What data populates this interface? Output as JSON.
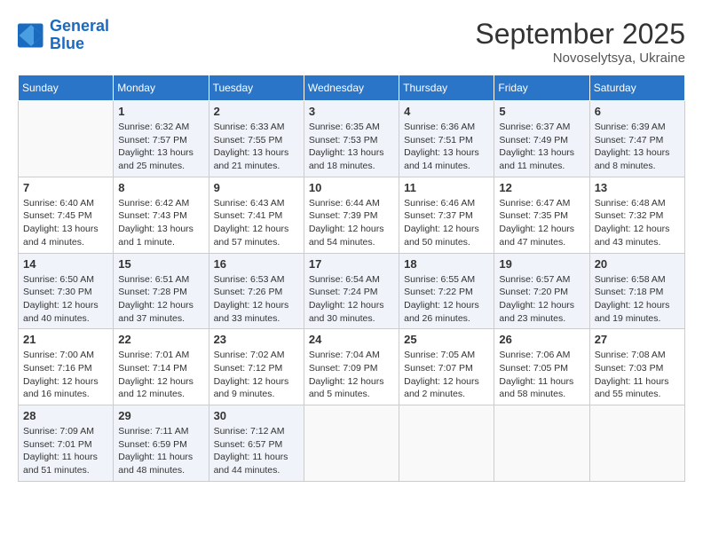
{
  "header": {
    "logo_line1": "General",
    "logo_line2": "Blue",
    "month": "September 2025",
    "location": "Novoselytsya, Ukraine"
  },
  "weekdays": [
    "Sunday",
    "Monday",
    "Tuesday",
    "Wednesday",
    "Thursday",
    "Friday",
    "Saturday"
  ],
  "weeks": [
    [
      {
        "day": "",
        "info": ""
      },
      {
        "day": "1",
        "info": "Sunrise: 6:32 AM\nSunset: 7:57 PM\nDaylight: 13 hours\nand 25 minutes."
      },
      {
        "day": "2",
        "info": "Sunrise: 6:33 AM\nSunset: 7:55 PM\nDaylight: 13 hours\nand 21 minutes."
      },
      {
        "day": "3",
        "info": "Sunrise: 6:35 AM\nSunset: 7:53 PM\nDaylight: 13 hours\nand 18 minutes."
      },
      {
        "day": "4",
        "info": "Sunrise: 6:36 AM\nSunset: 7:51 PM\nDaylight: 13 hours\nand 14 minutes."
      },
      {
        "day": "5",
        "info": "Sunrise: 6:37 AM\nSunset: 7:49 PM\nDaylight: 13 hours\nand 11 minutes."
      },
      {
        "day": "6",
        "info": "Sunrise: 6:39 AM\nSunset: 7:47 PM\nDaylight: 13 hours\nand 8 minutes."
      }
    ],
    [
      {
        "day": "7",
        "info": "Sunrise: 6:40 AM\nSunset: 7:45 PM\nDaylight: 13 hours\nand 4 minutes."
      },
      {
        "day": "8",
        "info": "Sunrise: 6:42 AM\nSunset: 7:43 PM\nDaylight: 13 hours\nand 1 minute."
      },
      {
        "day": "9",
        "info": "Sunrise: 6:43 AM\nSunset: 7:41 PM\nDaylight: 12 hours\nand 57 minutes."
      },
      {
        "day": "10",
        "info": "Sunrise: 6:44 AM\nSunset: 7:39 PM\nDaylight: 12 hours\nand 54 minutes."
      },
      {
        "day": "11",
        "info": "Sunrise: 6:46 AM\nSunset: 7:37 PM\nDaylight: 12 hours\nand 50 minutes."
      },
      {
        "day": "12",
        "info": "Sunrise: 6:47 AM\nSunset: 7:35 PM\nDaylight: 12 hours\nand 47 minutes."
      },
      {
        "day": "13",
        "info": "Sunrise: 6:48 AM\nSunset: 7:32 PM\nDaylight: 12 hours\nand 43 minutes."
      }
    ],
    [
      {
        "day": "14",
        "info": "Sunrise: 6:50 AM\nSunset: 7:30 PM\nDaylight: 12 hours\nand 40 minutes."
      },
      {
        "day": "15",
        "info": "Sunrise: 6:51 AM\nSunset: 7:28 PM\nDaylight: 12 hours\nand 37 minutes."
      },
      {
        "day": "16",
        "info": "Sunrise: 6:53 AM\nSunset: 7:26 PM\nDaylight: 12 hours\nand 33 minutes."
      },
      {
        "day": "17",
        "info": "Sunrise: 6:54 AM\nSunset: 7:24 PM\nDaylight: 12 hours\nand 30 minutes."
      },
      {
        "day": "18",
        "info": "Sunrise: 6:55 AM\nSunset: 7:22 PM\nDaylight: 12 hours\nand 26 minutes."
      },
      {
        "day": "19",
        "info": "Sunrise: 6:57 AM\nSunset: 7:20 PM\nDaylight: 12 hours\nand 23 minutes."
      },
      {
        "day": "20",
        "info": "Sunrise: 6:58 AM\nSunset: 7:18 PM\nDaylight: 12 hours\nand 19 minutes."
      }
    ],
    [
      {
        "day": "21",
        "info": "Sunrise: 7:00 AM\nSunset: 7:16 PM\nDaylight: 12 hours\nand 16 minutes."
      },
      {
        "day": "22",
        "info": "Sunrise: 7:01 AM\nSunset: 7:14 PM\nDaylight: 12 hours\nand 12 minutes."
      },
      {
        "day": "23",
        "info": "Sunrise: 7:02 AM\nSunset: 7:12 PM\nDaylight: 12 hours\nand 9 minutes."
      },
      {
        "day": "24",
        "info": "Sunrise: 7:04 AM\nSunset: 7:09 PM\nDaylight: 12 hours\nand 5 minutes."
      },
      {
        "day": "25",
        "info": "Sunrise: 7:05 AM\nSunset: 7:07 PM\nDaylight: 12 hours\nand 2 minutes."
      },
      {
        "day": "26",
        "info": "Sunrise: 7:06 AM\nSunset: 7:05 PM\nDaylight: 11 hours\nand 58 minutes."
      },
      {
        "day": "27",
        "info": "Sunrise: 7:08 AM\nSunset: 7:03 PM\nDaylight: 11 hours\nand 55 minutes."
      }
    ],
    [
      {
        "day": "28",
        "info": "Sunrise: 7:09 AM\nSunset: 7:01 PM\nDaylight: 11 hours\nand 51 minutes."
      },
      {
        "day": "29",
        "info": "Sunrise: 7:11 AM\nSunset: 6:59 PM\nDaylight: 11 hours\nand 48 minutes."
      },
      {
        "day": "30",
        "info": "Sunrise: 7:12 AM\nSunset: 6:57 PM\nDaylight: 11 hours\nand 44 minutes."
      },
      {
        "day": "",
        "info": ""
      },
      {
        "day": "",
        "info": ""
      },
      {
        "day": "",
        "info": ""
      },
      {
        "day": "",
        "info": ""
      }
    ]
  ]
}
